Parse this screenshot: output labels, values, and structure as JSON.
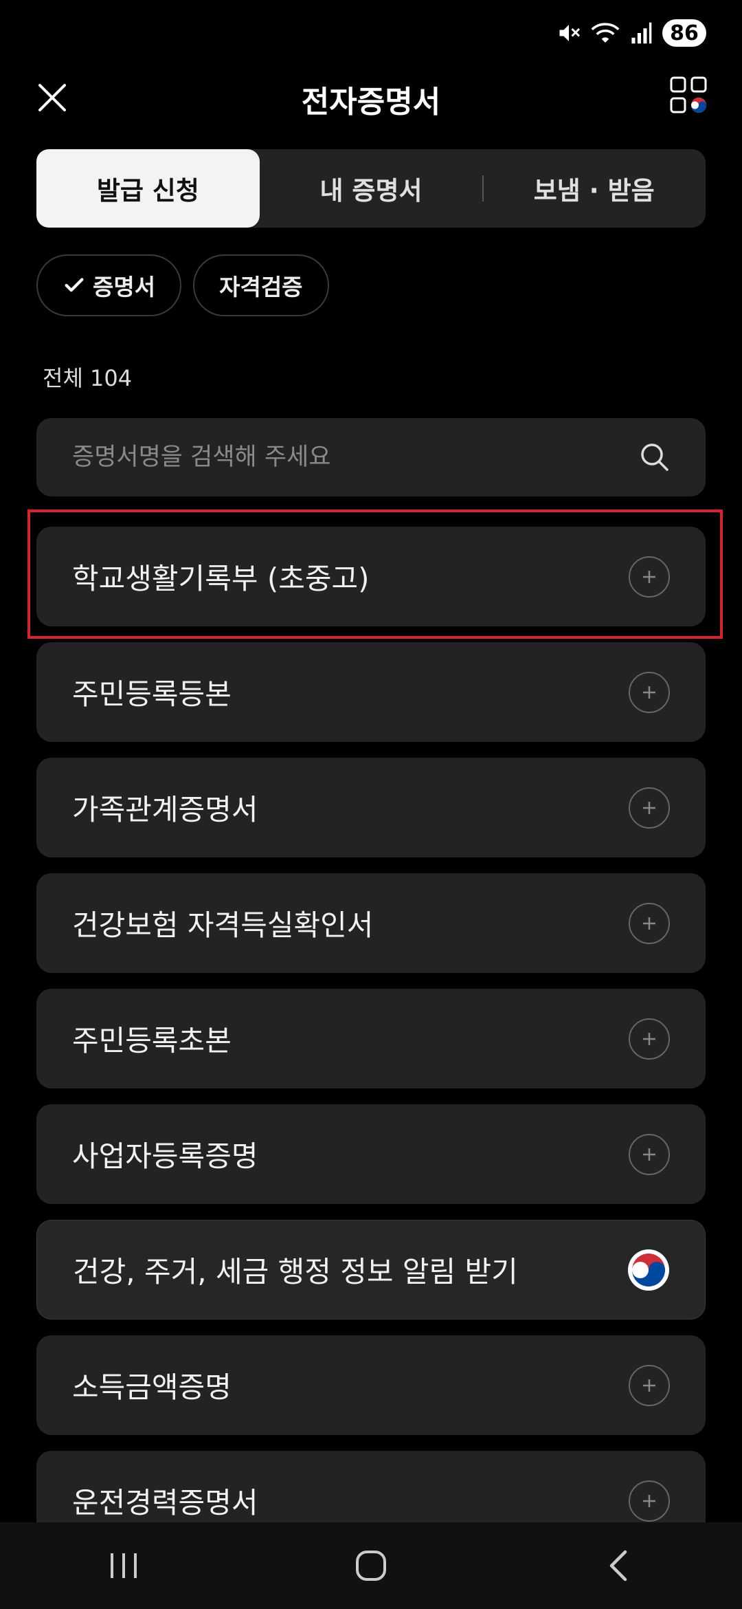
{
  "status_bar": {
    "battery": "86"
  },
  "header": {
    "title": "전자증명서"
  },
  "tabs": [
    {
      "label": "발급 신청",
      "active": true
    },
    {
      "label": "내 증명서",
      "active": false
    },
    {
      "label": "보냄 · 받음",
      "active": false
    }
  ],
  "chips": [
    {
      "label": "증명서",
      "selected": true
    },
    {
      "label": "자격검증",
      "selected": false
    }
  ],
  "count_label": "전체 104",
  "search": {
    "placeholder": "증명서명을 검색해 주세요"
  },
  "items": [
    {
      "label": "학교생활기록부 (초중고)",
      "action": "plus"
    },
    {
      "label": "주민등록등본",
      "action": "plus"
    },
    {
      "label": "가족관계증명서",
      "action": "plus"
    },
    {
      "label": "건강보험 자격득실확인서",
      "action": "plus"
    },
    {
      "label": "주민등록초본",
      "action": "plus"
    },
    {
      "label": "사업자등록증명",
      "action": "plus"
    },
    {
      "label": "건강, 주거, 세금 행정 정보 알림 받기",
      "action": "gov-emblem"
    },
    {
      "label": "소득금액증명",
      "action": "plus"
    },
    {
      "label": "운전경력증명서",
      "action": "plus"
    }
  ],
  "colors": {
    "background": "#000000",
    "card": "#232323",
    "highlight_border": "#d7232f"
  }
}
